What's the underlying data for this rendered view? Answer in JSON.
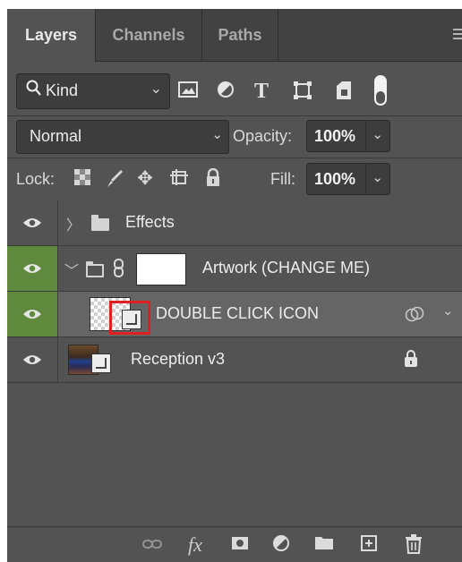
{
  "tabs": [
    {
      "label": "Layers",
      "active": true
    },
    {
      "label": "Channels",
      "active": false
    },
    {
      "label": "Paths",
      "active": false
    }
  ],
  "filter": {
    "kind_label": "Kind",
    "icons": [
      "image-filter-icon",
      "adjustment-filter-icon",
      "type-filter-icon",
      "shape-filter-icon",
      "smart-object-filter-icon",
      "filter-toggle"
    ]
  },
  "blend": {
    "mode": "Normal",
    "opacity_label": "Opacity:",
    "opacity_value": "100%"
  },
  "lock": {
    "label": "Lock:",
    "icons": [
      "lock-transparent-pixels-icon",
      "lock-image-pixels-icon",
      "lock-position-icon",
      "lock-artboard-icon",
      "lock-all-icon"
    ],
    "fill_label": "Fill:",
    "fill_value": "100%"
  },
  "layers": [
    {
      "name": "Effects",
      "type": "group",
      "expanded": false,
      "visible": true,
      "selected": false
    },
    {
      "name": "Artwork (CHANGE ME)",
      "type": "group",
      "expanded": true,
      "visible": true,
      "selected": false,
      "linked": true
    },
    {
      "name": "DOUBLE CLICK ICON",
      "type": "smart-object",
      "visible": true,
      "selected": true
    },
    {
      "name": "Reception v3",
      "type": "smart-object",
      "visible": true,
      "selected": false,
      "locked": true
    }
  ],
  "bottom_icons": [
    "link-layers-icon",
    "fx-icon",
    "add-mask-icon",
    "adjustment-layer-icon",
    "new-group-icon",
    "new-layer-icon",
    "delete-icon"
  ],
  "fx_label": "fx",
  "colors": {
    "panel_bg": "#535353",
    "tab_bar_bg": "#424242",
    "visibility_highlight": "#5f8a3d",
    "selected_row": "#656565",
    "highlight_box": "#e02020"
  }
}
